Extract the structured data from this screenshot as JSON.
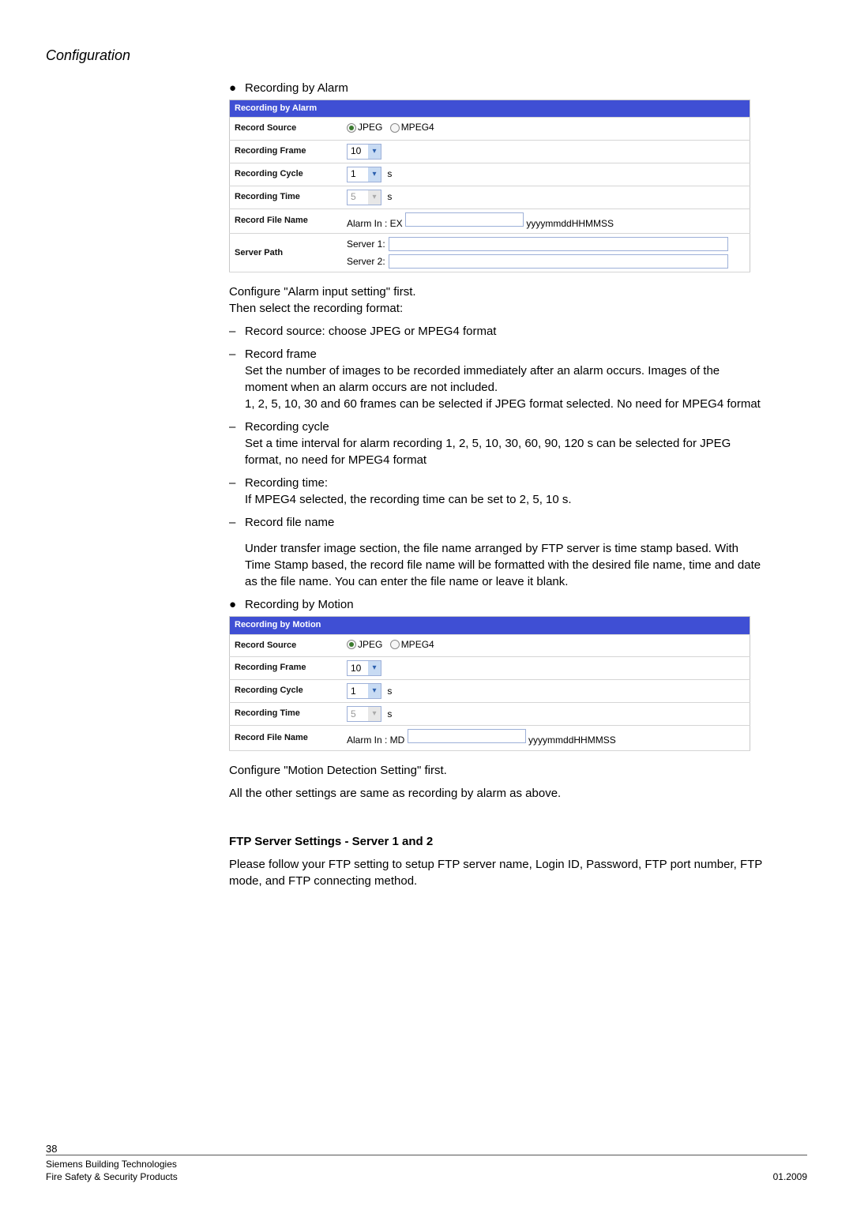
{
  "header": {
    "section": "Configuration"
  },
  "recordingByAlarm": {
    "bulletTitle": "Recording by Alarm",
    "tableHeader": "Recording by Alarm",
    "rows": {
      "recordSource": {
        "label": "Record Source",
        "jpeg": "JPEG",
        "mpeg": "MPEG4"
      },
      "recordingFrame": {
        "label": "Recording Frame",
        "value": "10"
      },
      "recordingCycle": {
        "label": "Recording Cycle",
        "value": "1",
        "unit": "s"
      },
      "recordingTime": {
        "label": "Recording Time",
        "value": "5",
        "unit": "s"
      },
      "recordFileName": {
        "label": "Record File Name",
        "prefix": "Alarm In : EX",
        "suffix": "yyyymmddHHMMSS"
      },
      "serverPath": {
        "label": "Server Path",
        "s1": "Server 1:",
        "s2": "Server 2:"
      }
    }
  },
  "alarmText": {
    "p1": "Configure \"Alarm input setting\" first.",
    "p2": "Then select the recording format:",
    "li1_t": "Record source: choose JPEG or MPEG4 format",
    "li2_t": "Record frame",
    "li2_p1": "Set the number of images to be recorded immediately after an alarm occurs. Images of the moment when an alarm occurs are not included.",
    "li2_p2": "1, 2, 5, 10, 30 and 60 frames can be selected if JPEG format selected. No need for MPEG4 format",
    "li3_t": "Recording cycle",
    "li3_p": "Set a time interval for alarm recording 1, 2, 5, 10, 30, 60, 90, 120 s can be selected for JPEG format, no need for MPEG4 format",
    "li4_t": "Recording time:",
    "li4_p": "If MPEG4 selected, the recording time can be set to 2, 5, 10 s.",
    "li5_t": "Record file name",
    "li5_p": "Under transfer image section, the file name arranged by FTP server is time stamp based. With Time Stamp based, the record file name will be formatted with the desired file name, time and date as the file name. You can enter the file name or leave it blank."
  },
  "recordingByMotion": {
    "bulletTitle": "Recording by Motion",
    "tableHeader": "Recording by Motion",
    "rows": {
      "recordSource": {
        "label": "Record Source",
        "jpeg": "JPEG",
        "mpeg": "MPEG4"
      },
      "recordingFrame": {
        "label": "Recording Frame",
        "value": "10"
      },
      "recordingCycle": {
        "label": "Recording Cycle",
        "value": "1",
        "unit": "s"
      },
      "recordingTime": {
        "label": "Recording Time",
        "value": "5",
        "unit": "s"
      },
      "recordFileName": {
        "label": "Record File Name",
        "prefix": "Alarm In : MD",
        "suffix": "yyyymmddHHMMSS"
      }
    }
  },
  "motionText": {
    "p1": "Configure \"Motion Detection Setting\" first.",
    "p2": "All the other settings are same as recording by alarm as above."
  },
  "ftp": {
    "title": "FTP Server Settings - Server 1 and 2",
    "p": "Please follow your FTP setting to setup FTP server name, Login ID, Password, FTP port number, FTP mode, and FTP connecting method."
  },
  "footer": {
    "page": "38",
    "l1": "Siemens Building Technologies",
    "l2": "Fire Safety & Security Products",
    "r2": "01.2009"
  }
}
